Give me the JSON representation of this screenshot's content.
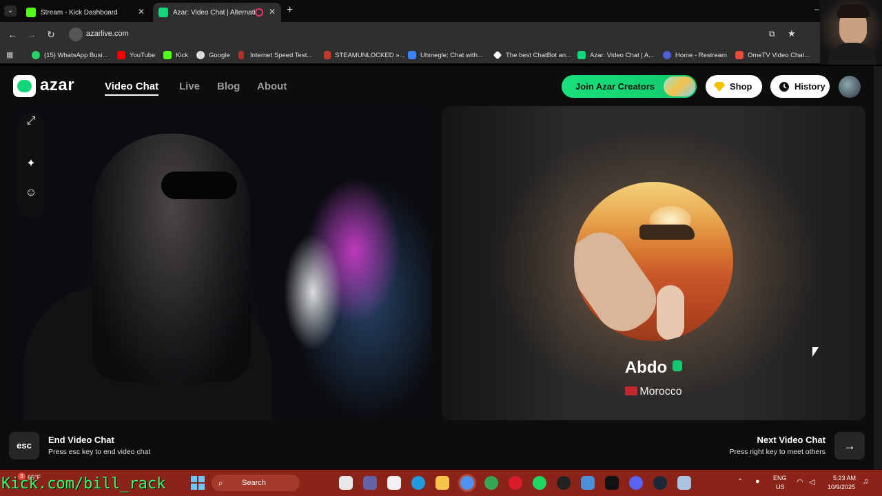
{
  "browser": {
    "tabs": [
      {
        "title": "Stream - Kick Dashboard",
        "icon": "kick-icon",
        "color": "#53fc18"
      },
      {
        "title": "Azar: Video Chat | Alternati",
        "icon": "azar-icon",
        "color": "#14d67a",
        "active": true
      }
    ],
    "url": "azarlive.com",
    "bookmarks": [
      {
        "label": "(15) WhatsApp Busi...",
        "icon": "whatsapp-icon",
        "color": "#25d366"
      },
      {
        "label": "YouTube",
        "icon": "youtube-icon",
        "color": "#ff0000"
      },
      {
        "label": "Kick",
        "icon": "kick-icon",
        "color": "#53fc18"
      },
      {
        "label": "Google",
        "icon": "google-icon",
        "color": "#dddddd"
      },
      {
        "label": "Internet Speed Test...",
        "icon": "speedtest-icon",
        "color": "#b0302a"
      },
      {
        "label": "STEAMUNLOCKED »...",
        "icon": "steamunlocked-icon",
        "color": "#c0392b"
      },
      {
        "label": "Uhmegle: Chat with...",
        "icon": "uhmegle-icon",
        "color": "#3b82f6"
      },
      {
        "label": "The best ChatBot an...",
        "icon": "chatbot-icon",
        "color": "#ffffff"
      },
      {
        "label": "Azar: Video Chat | A...",
        "icon": "azar-icon",
        "color": "#14d67a"
      },
      {
        "label": "Home - Restream",
        "icon": "restream-icon",
        "color": "#4c5fd5"
      },
      {
        "label": "OmeTV Video Chat...",
        "icon": "ometv-icon",
        "color": "#e74c3c"
      }
    ]
  },
  "site": {
    "logo_text": "azar",
    "nav": [
      "Video Chat",
      "Live",
      "Blog",
      "About"
    ],
    "join_button": "Join Azar Creators",
    "shop_button": "Shop",
    "history_button": "History",
    "accent_color": "#14d67a"
  },
  "remote_user": {
    "name": "Abdo",
    "country": "Morocco"
  },
  "controls": {
    "esc_key": "esc",
    "end_title": "End Video Chat",
    "end_subtitle": "Press esc key to end video chat",
    "next_title": "Next Video Chat",
    "next_subtitle": "Press right key to meet others"
  },
  "taskbar": {
    "search_label": "Search",
    "weather_temp": "65°F",
    "weather_alert": "3",
    "lang_top": "ENG",
    "lang_bottom": "US",
    "time": "5:23 AM",
    "date": "10/9/2025"
  },
  "overlay": {
    "watermark": "Kick.com/bill_rack"
  }
}
